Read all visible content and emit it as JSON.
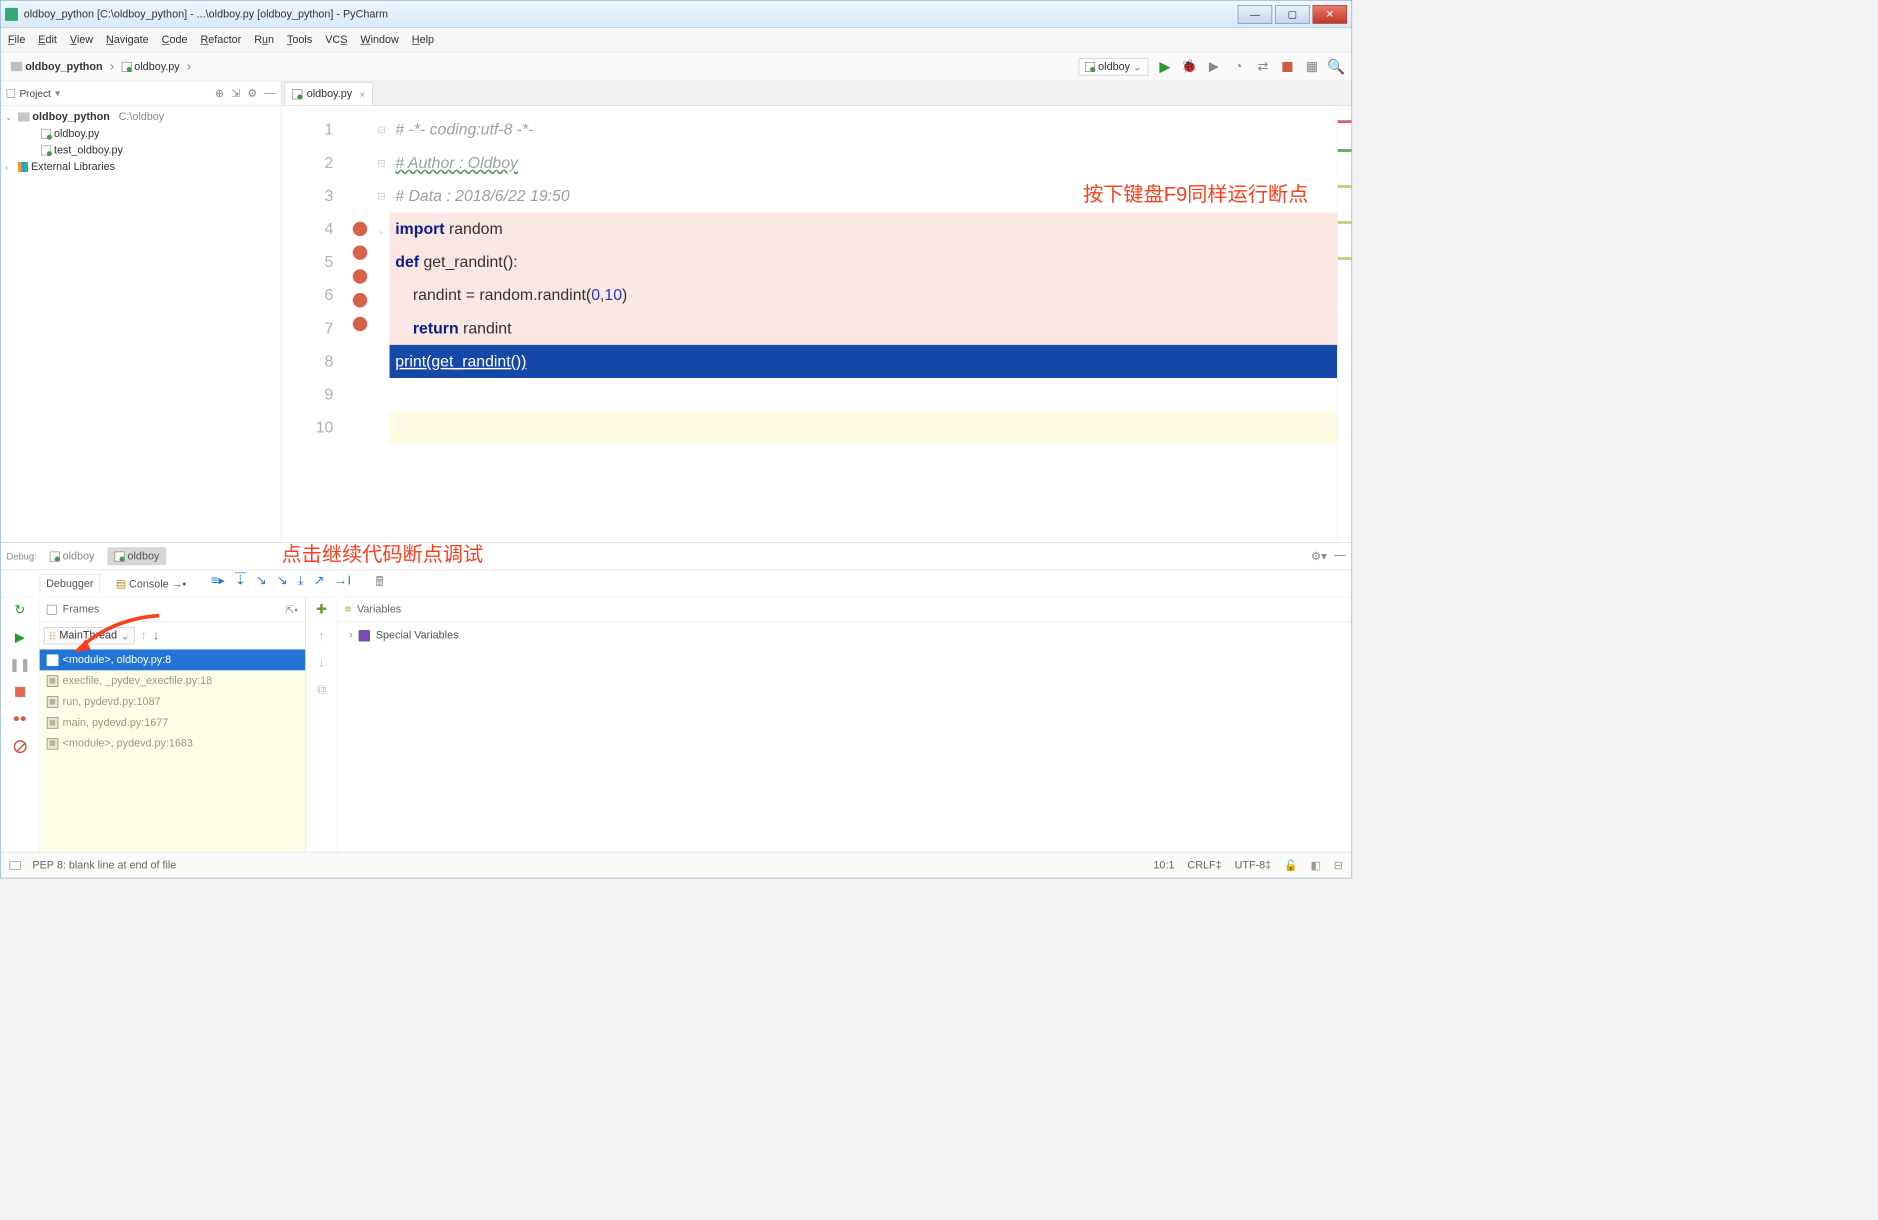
{
  "title": "oldboy_python [C:\\oldboy_python] - ...\\oldboy.py [oldboy_python] - PyCharm",
  "menu": [
    "File",
    "Edit",
    "View",
    "Navigate",
    "Code",
    "Refactor",
    "Run",
    "Tools",
    "VCS",
    "Window",
    "Help"
  ],
  "breadcrumb": {
    "root": "oldboy_python",
    "file": "oldboy.py"
  },
  "run_config": "oldboy",
  "project": {
    "header": "Project",
    "root": "oldboy_python",
    "root_path": "C:\\oldboy",
    "files": [
      "oldboy.py",
      "test_oldboy.py"
    ],
    "ext": "External Libraries"
  },
  "editor_tab": "oldboy.py",
  "code": {
    "l1": "# -*- coding:utf-8 -*-",
    "l2": "# Author : Oldboy",
    "l3": "# Data : 2018/6/22 19:50",
    "l4a": "import",
    "l4b": " random",
    "l5a": "def",
    "l5b": " get_randint():",
    "l6": "    randint = random.randint(0,10)",
    "l7a": "    ",
    "l7b": "return",
    "l7c": " randint",
    "l8a": "print",
    "l8b": "(get_randint())"
  },
  "annotation1": "按下键盘F9同样运行断点",
  "annotation2": "点击继续代码断点调试",
  "debug": {
    "label": "Debug:",
    "tabs": [
      "oldboy",
      "oldboy"
    ],
    "subtabs": {
      "a": "Debugger",
      "b": "Console"
    },
    "frames_label": "Frames",
    "vars_label": "Variables",
    "thread": "MainThread",
    "frames": [
      "<module>, oldboy.py:8",
      "execfile, _pydev_execfile.py:18",
      "run, pydevd.py:1087",
      "main, pydevd.py:1677",
      "<module>, pydevd.py:1683"
    ],
    "special_vars": "Special Variables"
  },
  "status": {
    "msg": "PEP 8: blank line at end of file",
    "pos": "10:1",
    "eol": "CRLF",
    "enc": "UTF-8"
  }
}
